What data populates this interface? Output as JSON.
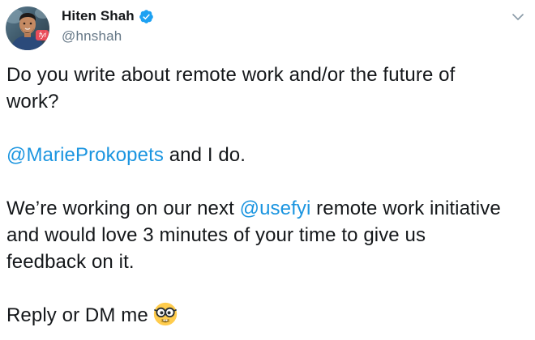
{
  "author": {
    "display_name": "Hiten Shah",
    "handle": "@hnshah",
    "avatar_badge": "fyi",
    "verified_icon": "verified-badge-icon",
    "avatar_icon": "profile-photo"
  },
  "menu": {
    "icon": "chevron-down-icon"
  },
  "tweet": {
    "p1": "Do you write about remote work and/or the future of work?",
    "p1_line1": "Do you write about remote work and/or the future of",
    "p1_line2": "work?",
    "p2_mention": "@MarieProkopets",
    "p2_rest": " and I do.",
    "p3_pre": "We’re working on our next ",
    "p3_mention": "@usefyi",
    "p3_post1": " remote work initiative",
    "p3_line2": "and would love 3 minutes of your time to give us",
    "p3_line3": "feedback on it.",
    "p4_text": "Reply or DM me",
    "p4_emoji": "nerd-face-emoji"
  },
  "colors": {
    "text": "#14171a",
    "secondary": "#657786",
    "link": "#1b95e0",
    "verified": "#1da1f2",
    "badge": "#ea4c5a"
  }
}
